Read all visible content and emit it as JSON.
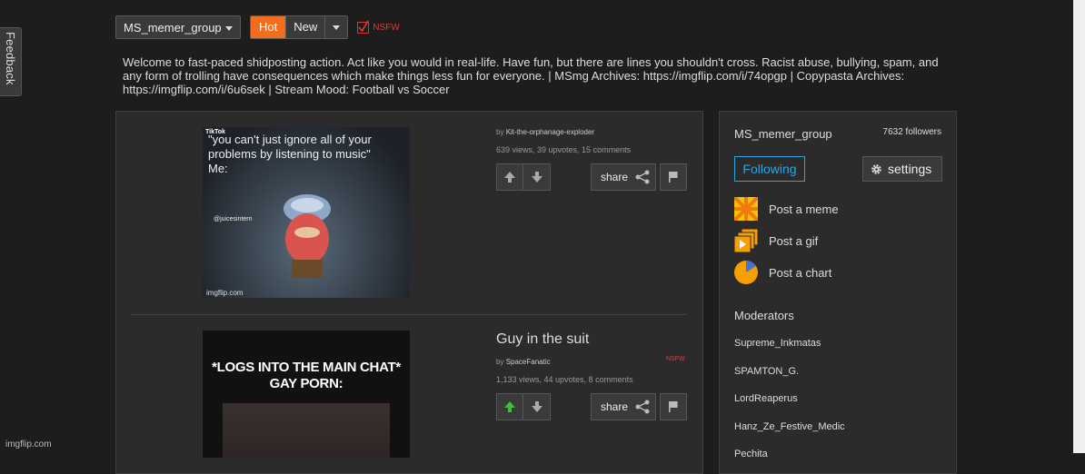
{
  "feedback_tab": "Feedback",
  "topbar": {
    "group": "MS_memer_group",
    "sort_hot": "Hot",
    "sort_new": "New",
    "nsfw": "NSFW"
  },
  "description": "Welcome to fast-paced shidposting action. Act like you would in real-life. Have fun, but there are lines you shouldn't cross. Racist abuse, bullying, spam, and any form of trolling have consequences which make things less fun for everyone. | MSmg Archives: https://imgflip.com/i/74opgp | Copypasta Archives: https://imgflip.com/i/6u6sek | Stream Mood: Football vs Soccer",
  "posts": [
    {
      "title": "",
      "by_prefix": "by",
      "author": "Kit-the-orphanage-exploder",
      "stats": "639 views, 39 upvotes, 15 comments",
      "share": "share",
      "image_caption": "\"you can't just ignore all of your problems by listening to music\"\nMe:",
      "image_watermark": "imgflip.com",
      "image_tiktok": "TikTok",
      "image_handle": "@juicesintern"
    },
    {
      "title": "Guy in the suit",
      "by_prefix": "by",
      "author": "SpaceFanatic",
      "stats": "1,133 views, 44 upvotes, 8 comments",
      "share": "share",
      "nsfw": "NSFW",
      "image_caption": "*LOGS INTO THE MAIN CHAT*\nGAY PORN:"
    }
  ],
  "sidebar": {
    "name": "MS_memer_group",
    "followers": "7632 followers",
    "following": "Following",
    "settings": "settings",
    "create": [
      {
        "label": "Post a meme"
      },
      {
        "label": "Post a gif"
      },
      {
        "label": "Post a chart"
      }
    ],
    "moderators_title": "Moderators",
    "moderators": [
      "Supreme_Inkmatas",
      "SPAMTON_G.",
      "LordReaperus",
      "Hanz_Ze_Festive_Medic",
      "Pechita"
    ]
  },
  "watermark": "imgflip.com",
  "colors": {
    "accent_orange": "#f26e1d",
    "following_blue": "#2aa6e8",
    "nsfw_red": "#e03a3a",
    "upvote_green": "#3fbf3f"
  }
}
